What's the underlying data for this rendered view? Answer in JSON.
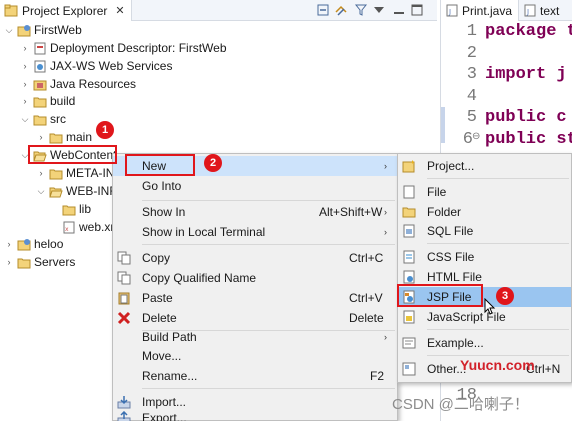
{
  "explorer": {
    "tab_title": "Project Explorer",
    "close_glyph": "✕",
    "toolbar_icons": [
      "collapse-all-icon",
      "link-with-editor-icon",
      "filter-icon",
      "view-menu-icon",
      "minimize-icon",
      "maximize-icon"
    ],
    "tree": [
      {
        "label": "FirstWeb",
        "icon": "web-project-icon",
        "expanded": true
      },
      {
        "label": "Deployment Descriptor: FirstWeb",
        "icon": "deployment-descriptor-icon",
        "expanded": false
      },
      {
        "label": "JAX-WS Web Services",
        "icon": "web-services-icon",
        "expanded": false
      },
      {
        "label": "Java Resources",
        "icon": "java-resources-icon",
        "expanded": false
      },
      {
        "label": "build",
        "icon": "folder-icon",
        "expanded": false
      },
      {
        "label": "src",
        "icon": "folder-icon",
        "expanded": true
      },
      {
        "label": "main",
        "icon": "folder-icon",
        "expanded": false
      },
      {
        "label": "WebContent",
        "icon": "folder-open-icon",
        "expanded": true
      },
      {
        "label": "META-IN",
        "icon": "folder-icon",
        "expanded": false
      },
      {
        "label": "WEB-INF",
        "icon": "folder-open-icon",
        "expanded": true
      },
      {
        "label": "lib",
        "icon": "folder-icon",
        "expanded": false
      },
      {
        "label": "web.xn",
        "icon": "xml-file-icon",
        "expanded": false
      },
      {
        "label": "heloo",
        "icon": "web-project-icon",
        "expanded": false
      },
      {
        "label": "Servers",
        "icon": "folder-icon",
        "expanded": false
      }
    ]
  },
  "editor": {
    "tabs": [
      "Print.java",
      "text"
    ],
    "line_numbers": [
      "1",
      "2",
      "3",
      "4",
      "5",
      "6",
      "18"
    ],
    "code_lines": [
      "package t",
      "",
      "import j",
      "",
      "public c",
      "public st"
    ],
    "fold_marker": "⊖"
  },
  "context_menu": {
    "items": [
      {
        "label": "New",
        "accel": "",
        "submenu": true,
        "icon": ""
      },
      {
        "label": "Go Into",
        "accel": "",
        "submenu": false,
        "icon": ""
      },
      {
        "label": "Show In",
        "accel": "Alt+Shift+W",
        "submenu": true,
        "icon": ""
      },
      {
        "label": "Show in Local Terminal",
        "accel": "",
        "submenu": true,
        "icon": ""
      },
      {
        "label": "Copy",
        "accel": "Ctrl+C",
        "submenu": false,
        "icon": "copy-icon"
      },
      {
        "label": "Copy Qualified Name",
        "accel": "",
        "submenu": false,
        "icon": "copy-qualified-name-icon"
      },
      {
        "label": "Paste",
        "accel": "Ctrl+V",
        "submenu": false,
        "icon": "paste-icon"
      },
      {
        "label": "Delete",
        "accel": "Delete",
        "submenu": false,
        "icon": "delete-icon"
      },
      {
        "label": "Build Path",
        "accel": "",
        "submenu": true,
        "icon": ""
      },
      {
        "label": "Move...",
        "accel": "",
        "submenu": false,
        "icon": ""
      },
      {
        "label": "Rename...",
        "accel": "F2",
        "submenu": false,
        "icon": ""
      },
      {
        "label": "Import...",
        "accel": "",
        "submenu": false,
        "icon": "import-icon"
      },
      {
        "label": "Export...",
        "accel": "",
        "submenu": false,
        "icon": "export-icon"
      }
    ]
  },
  "new_submenu": {
    "items": [
      {
        "label": "Project...",
        "icon": "new-project-icon"
      },
      {
        "label": "File",
        "icon": "new-file-icon"
      },
      {
        "label": "Folder",
        "icon": "new-folder-icon"
      },
      {
        "label": "SQL File",
        "icon": "sql-file-icon"
      },
      {
        "label": "CSS File",
        "icon": "css-file-icon"
      },
      {
        "label": "HTML File",
        "icon": "html-file-icon"
      },
      {
        "label": "JSP File",
        "icon": "jsp-file-icon"
      },
      {
        "label": "JavaScript File",
        "icon": "javascript-file-icon"
      },
      {
        "label": "Example...",
        "icon": "example-icon"
      },
      {
        "label": "Other...",
        "accel": "Ctrl+N",
        "icon": "other-icon"
      }
    ]
  },
  "annotations": {
    "badges": [
      "1",
      "2",
      "3"
    ],
    "color": "#e0161b"
  },
  "watermarks": {
    "yuucn": "Yuucn.com",
    "csdn": "CSDN @二哈喇子！"
  },
  "colors": {
    "menu_highlight": "#cde3fb",
    "menu_selected": "#9ac5f0",
    "keyword": "#7f0055"
  }
}
